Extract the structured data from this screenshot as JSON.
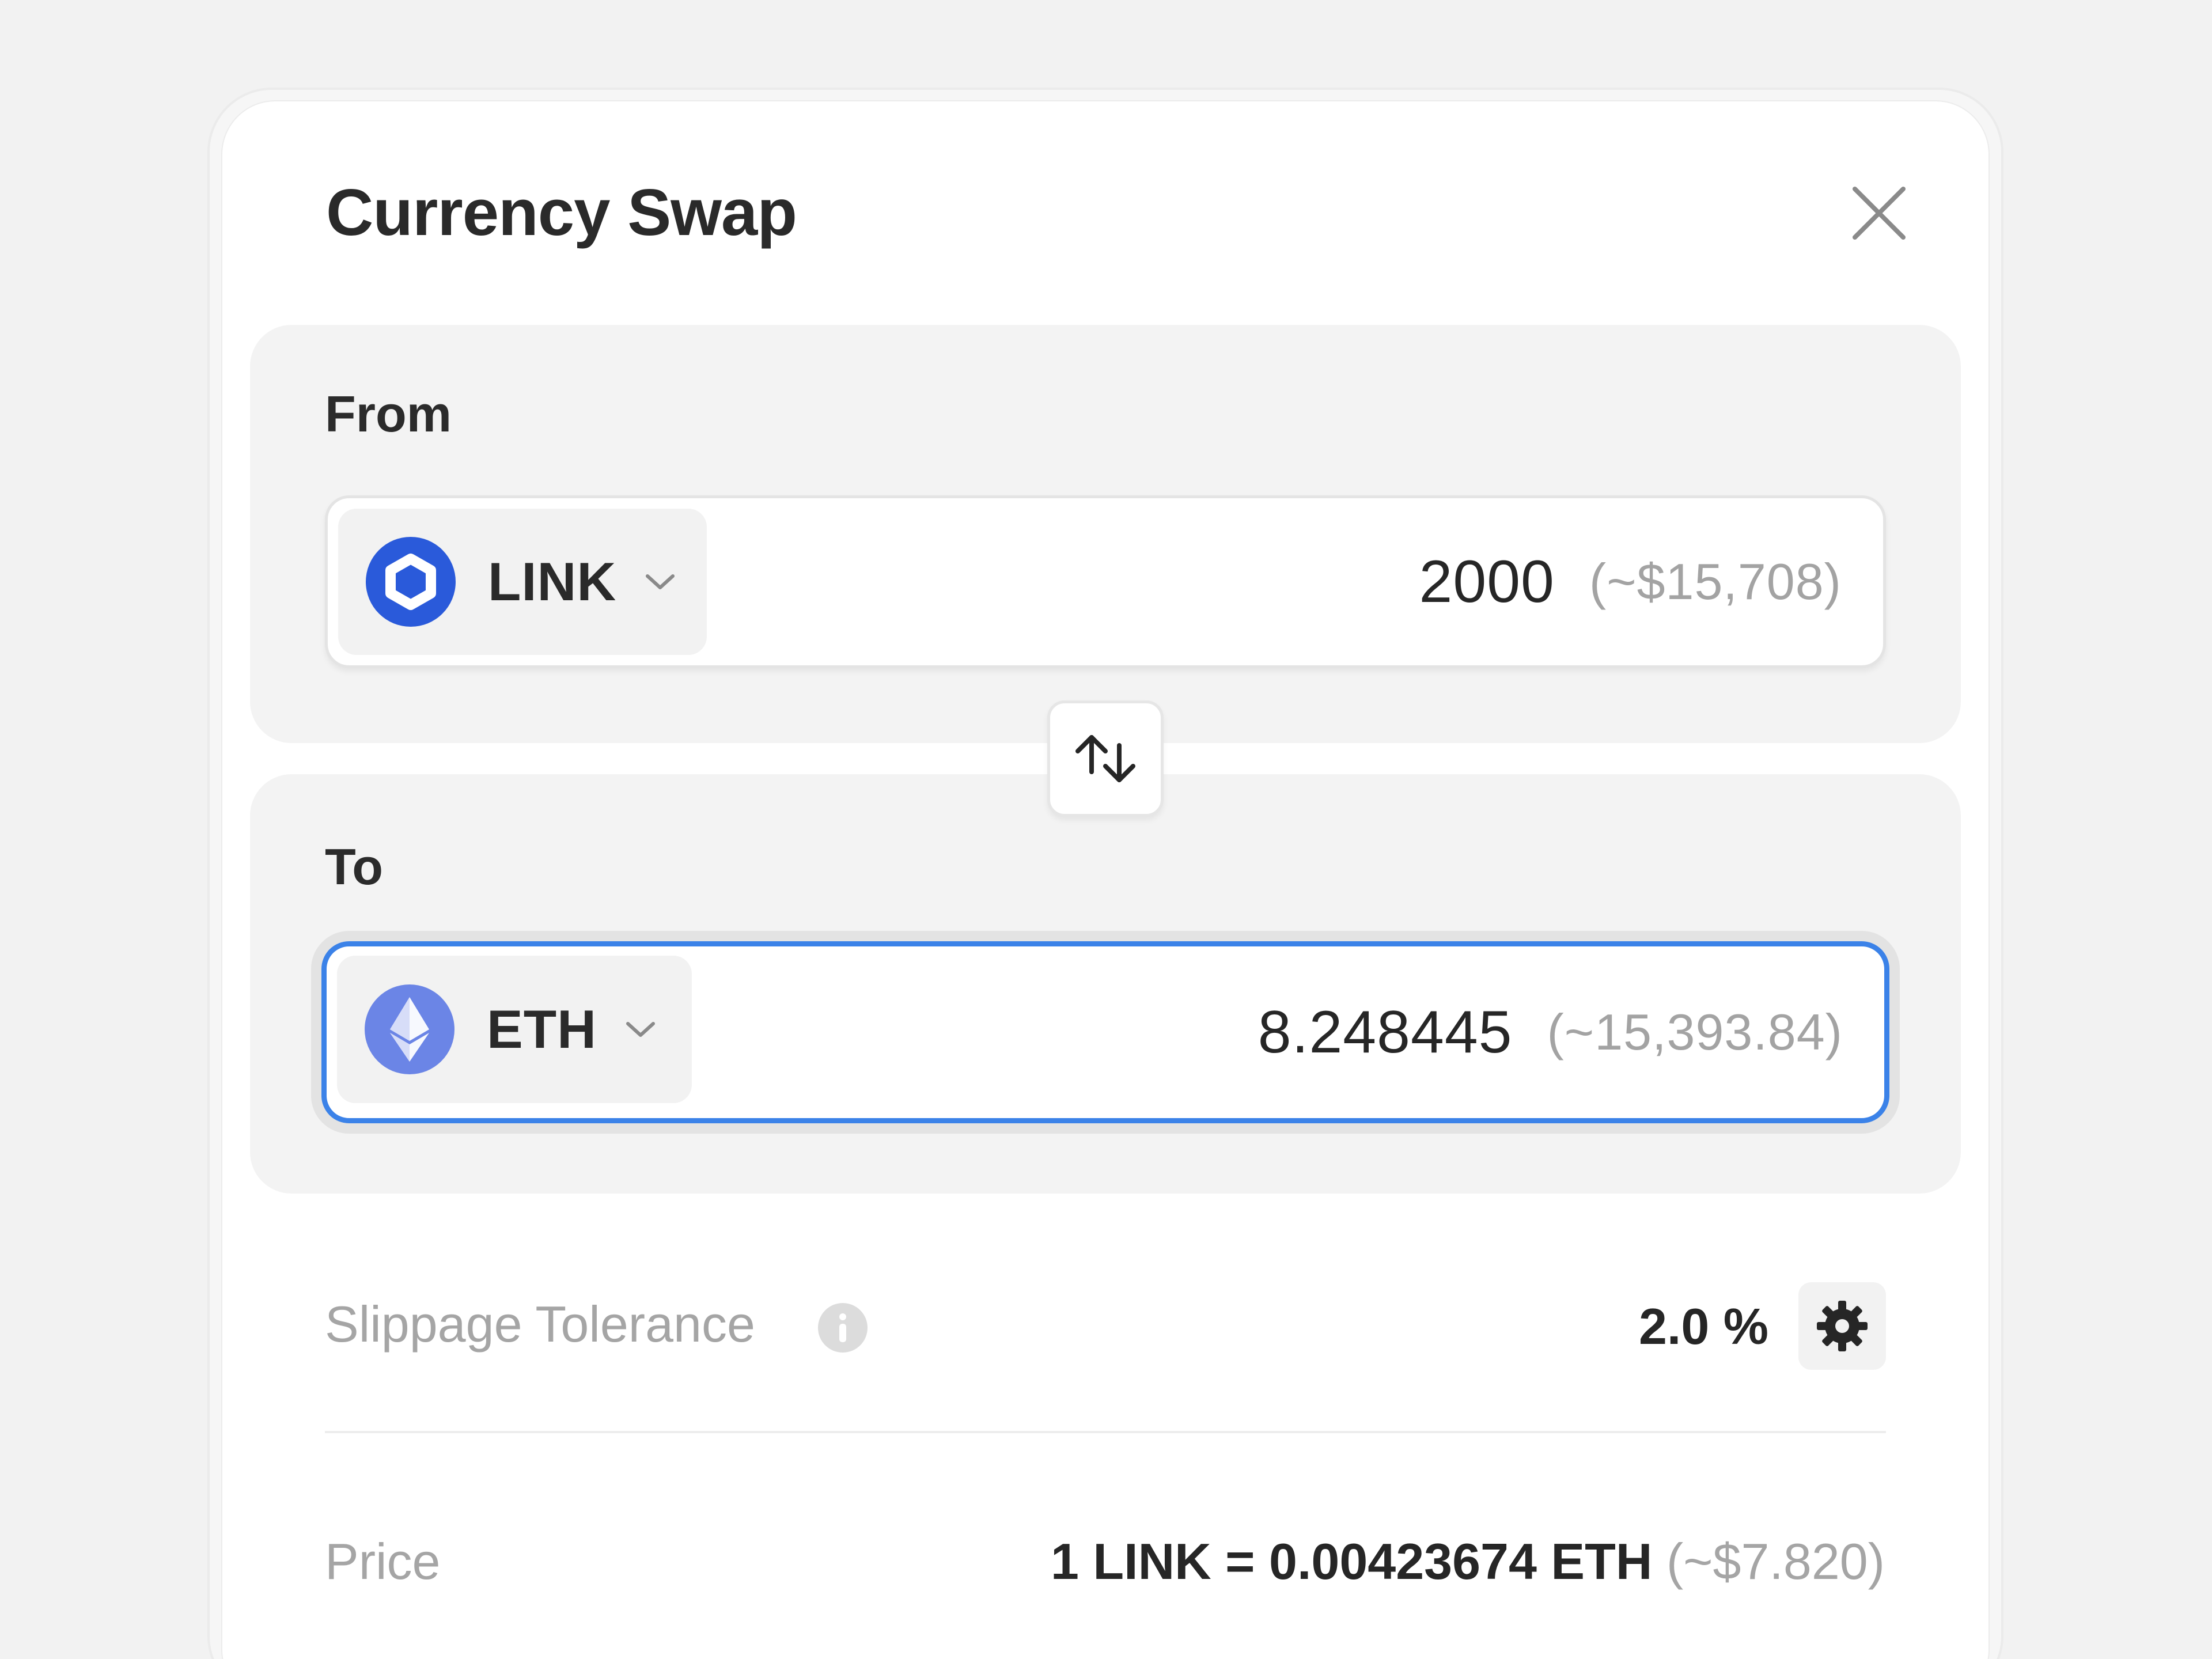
{
  "dialog": {
    "title": "Currency Swap",
    "close_icon": "close-icon"
  },
  "from": {
    "label": "From",
    "token": {
      "symbol": "LINK",
      "icon": "chainlink-icon",
      "color": "#2a5ada"
    },
    "amount": "2000",
    "usd_estimate": "(~$15,708)"
  },
  "swap_button": {
    "icon": "swap-arrows-icon"
  },
  "to": {
    "label": "To",
    "token": {
      "symbol": "ETH",
      "icon": "ethereum-icon",
      "color": "#6b85e6"
    },
    "amount": "8.248445",
    "usd_estimate": "(~15,393.84)",
    "focused": true,
    "focus_color": "#3b82e8"
  },
  "slippage": {
    "label": "Slippage Tolerance",
    "info_icon": "info-icon",
    "value": "2.0 %",
    "settings_icon": "gear-icon"
  },
  "price": {
    "label": "Price",
    "rate": "1 LINK = 0.00423674 ETH",
    "usd": "(~$7.820)"
  }
}
